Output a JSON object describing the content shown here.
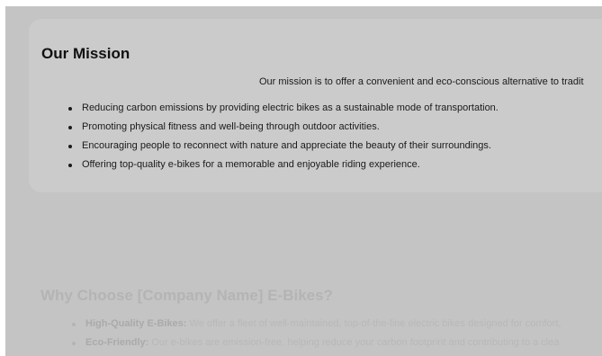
{
  "mission": {
    "title": "Our Mission",
    "intro": "Our mission is to offer a convenient and eco-conscious alternative to tradit",
    "items": [
      "Reducing carbon emissions by providing electric bikes as a sustainable mode of transportation.",
      "Promoting physical fitness and well-being through outdoor activities.",
      "Encouraging people to reconnect with nature and appreciate the beauty of their surroundings.",
      "Offering top-quality e-bikes for a memorable and enjoyable riding experience."
    ]
  },
  "why": {
    "title": "Why Choose [Company Name] E-Bikes?",
    "items": [
      {
        "label": "High-Quality E-Bikes:",
        "text": " We offer a fleet of well-maintained, top-of-the-line electric bikes designed for comfort,"
      },
      {
        "label": "Eco-Friendly:",
        "text": " Our e-bikes are emission-free, helping reduce your carbon footprint and contributing to a clea"
      }
    ]
  },
  "colors": {
    "overlay": "#c4c4c4",
    "card": "#cbcbcb",
    "text": "#1a1a1a",
    "muted_text": "#b8b8b8"
  }
}
